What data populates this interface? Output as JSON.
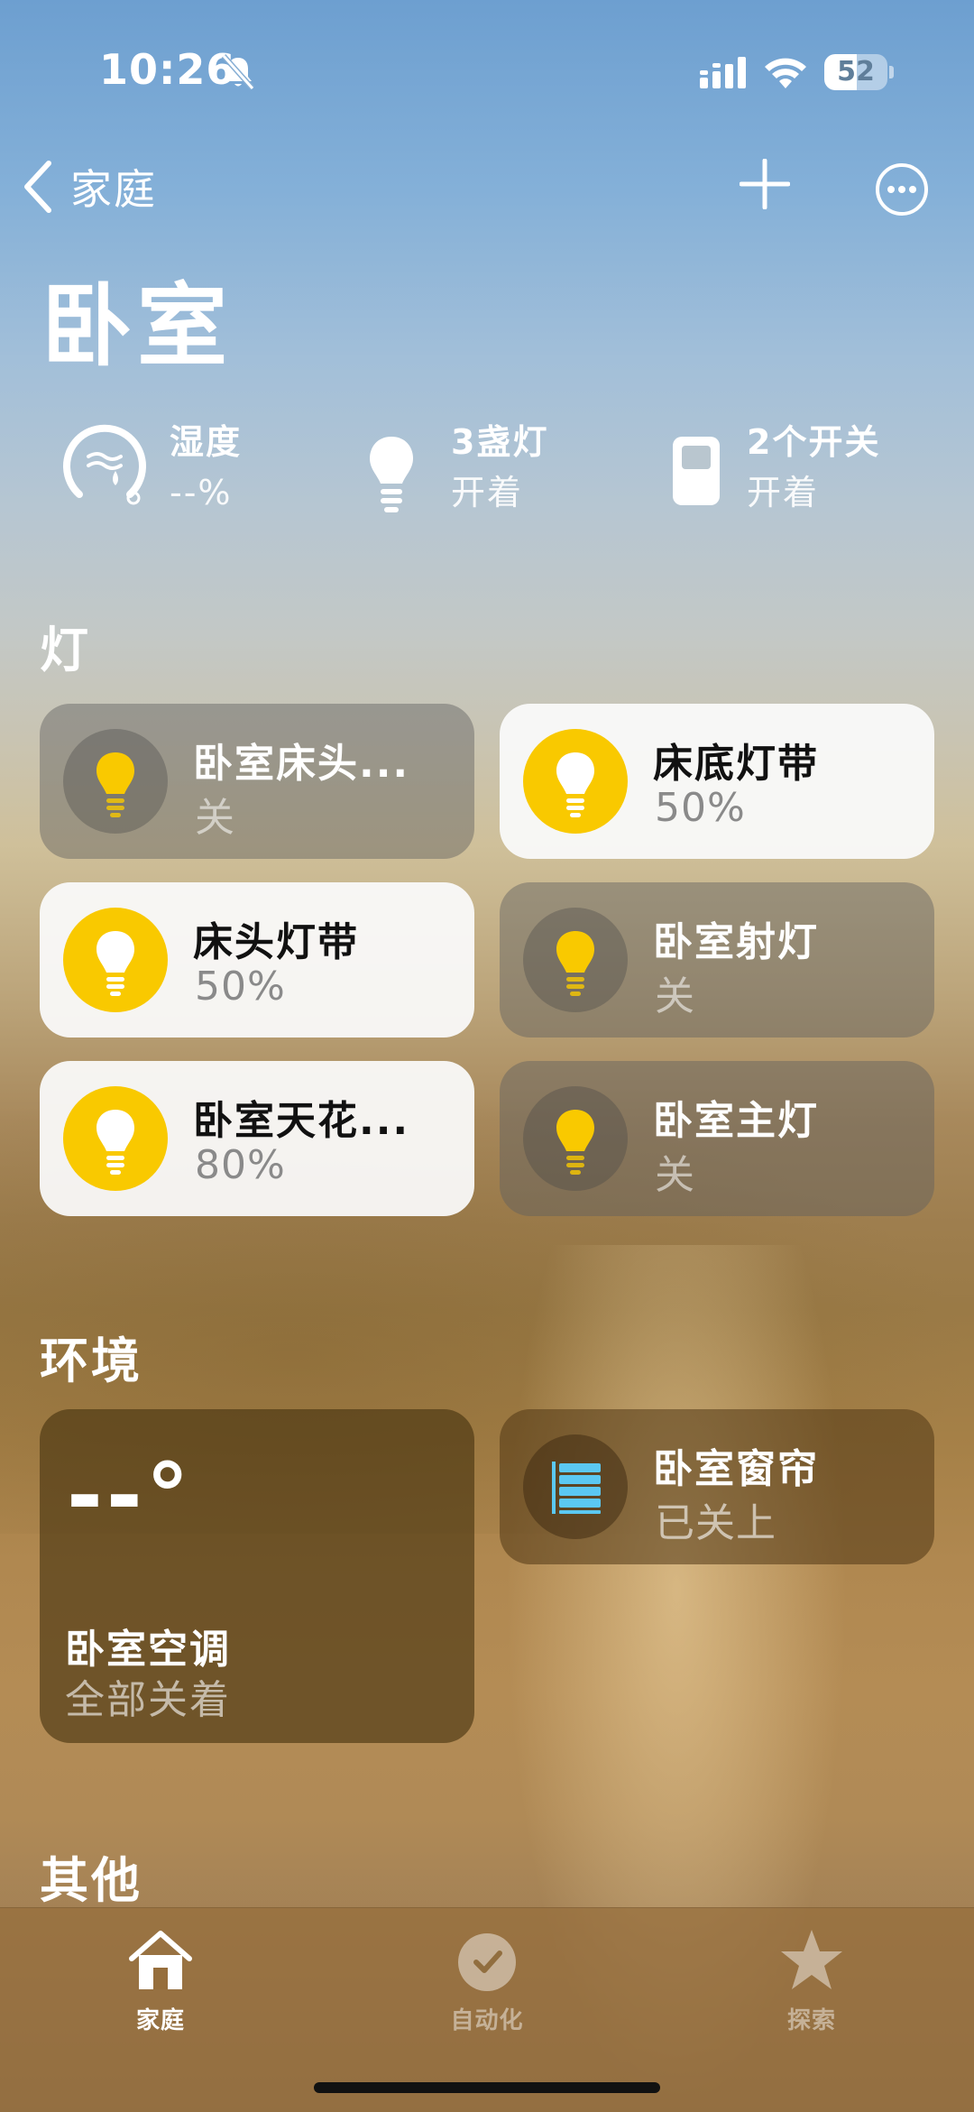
{
  "status_bar": {
    "time": "10:26",
    "battery_level": "52",
    "battery_fraction": 0.52,
    "icons": [
      "bell-slash-icon",
      "cellular-signal-icon",
      "wifi-icon",
      "battery-icon"
    ]
  },
  "nav": {
    "back_label": "家庭",
    "actions": [
      "plus-icon",
      "ellipsis-circle-icon"
    ]
  },
  "page": {
    "title": "卧室"
  },
  "summary": [
    {
      "icon": "humidity-gauge-icon",
      "line1": "湿度",
      "line2": "--%"
    },
    {
      "icon": "lightbulb-icon",
      "line1": "3盏灯",
      "line2": "开着"
    },
    {
      "icon": "switch-icon",
      "line1": "2个开关",
      "line2": "开着"
    }
  ],
  "sections": {
    "lights": "灯",
    "environment": "环境",
    "other": "其他"
  },
  "lights": [
    {
      "name": "卧室床头...",
      "status": "关",
      "on": false
    },
    {
      "name": "床底灯带",
      "status": "50%",
      "on": true
    },
    {
      "name": "床头灯带",
      "status": "50%",
      "on": true
    },
    {
      "name": "卧室射灯",
      "status": "关",
      "on": false
    },
    {
      "name": "卧室天花...",
      "status": "80%",
      "on": true
    },
    {
      "name": "卧室主灯",
      "status": "关",
      "on": false
    }
  ],
  "environment": {
    "ac": {
      "temp": "--°",
      "name": "卧室空调",
      "status": "全部关着"
    },
    "curtain": {
      "name": "卧室窗帘",
      "status": "已关上",
      "icon": "window-blinds-icon"
    }
  },
  "tabbar": [
    {
      "label": "家庭",
      "icon": "house-icon",
      "active": true
    },
    {
      "label": "自动化",
      "icon": "clock-check-icon",
      "active": false
    },
    {
      "label": "探索",
      "icon": "star-icon",
      "active": false
    }
  ],
  "colors": {
    "bulb_on": "#f9c900",
    "tile_on_bg": "#fafafa",
    "blinds_blue": "#5bc8f2"
  }
}
